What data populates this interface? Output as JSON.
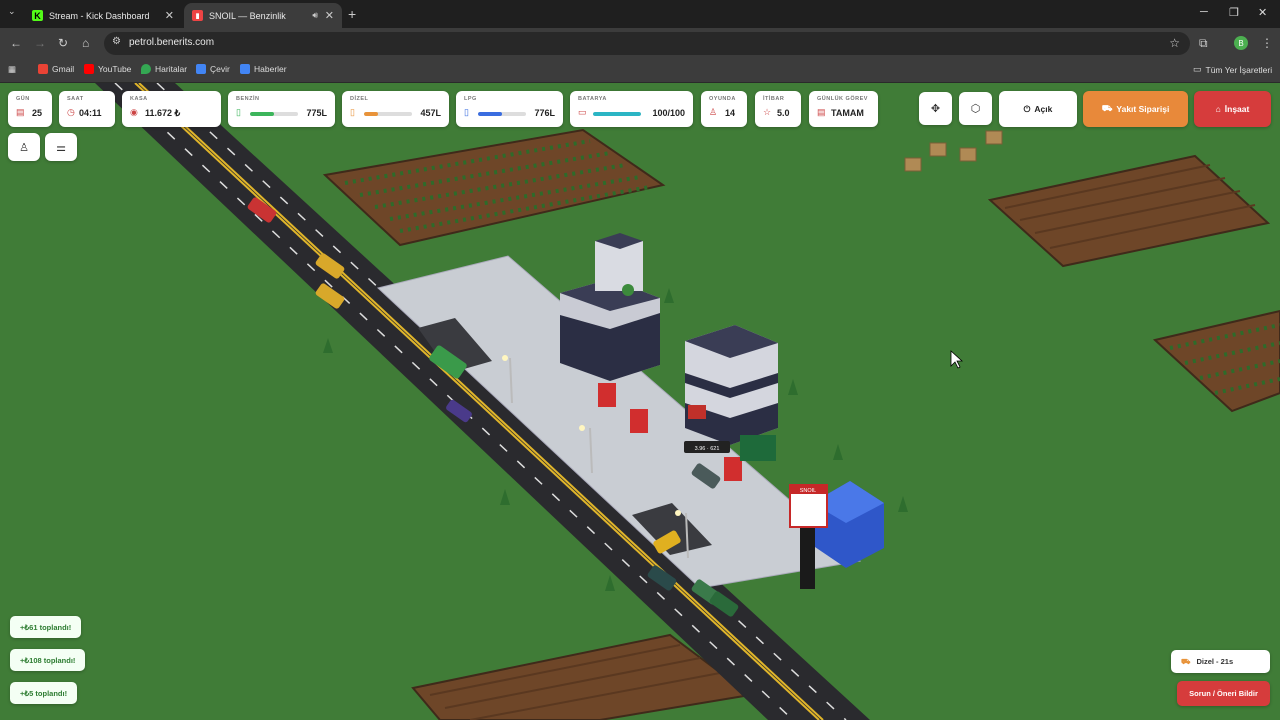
{
  "browser": {
    "tabs": [
      {
        "title": "Stream - Kick Dashboard",
        "icon": "kick-icon"
      },
      {
        "title": "SNOIL — Benzinlik",
        "icon": "snoil-icon"
      }
    ],
    "url": "petrol.benerits.com",
    "bookmarks": [
      {
        "label": "Gmail",
        "color": "#ea4335"
      },
      {
        "label": "YouTube",
        "color": "#ff0000"
      },
      {
        "label": "Haritalar",
        "color": "#34a853"
      },
      {
        "label": "Çevir",
        "color": "#4285f4"
      },
      {
        "label": "Haberler",
        "color": "#4285f4"
      }
    ],
    "all_bookmarks": "Tüm Yer İşaretleri",
    "profile_initial": "B"
  },
  "hud": {
    "gun": {
      "label": "GÜN",
      "value": "25"
    },
    "saat": {
      "label": "SAAT",
      "value": "04:11"
    },
    "kasa": {
      "label": "KASA",
      "value": "11.672 ₺"
    },
    "benzin": {
      "label": "BENZİN",
      "value": "775L",
      "level": 0.5,
      "color": "#3cb55b"
    },
    "dizel": {
      "label": "DİZEL",
      "value": "457L",
      "level": 0.3,
      "color": "#e8933a"
    },
    "lpg": {
      "label": "LPG",
      "value": "776L",
      "level": 0.5,
      "color": "#3a6de0"
    },
    "batarya": {
      "label": "BATARYA",
      "value": "100/100",
      "level": 1.0,
      "color": "#2bb5c4"
    },
    "oyunda": {
      "label": "OYUNDA",
      "value": "14"
    },
    "itibar": {
      "label": "İTİBAR",
      "value": "5.0"
    },
    "gorev": {
      "label": "GÜNLÜK GÖREV",
      "value": "TAMAM"
    }
  },
  "controls": {
    "acik": "Açık",
    "yakit_siparisi": "Yakıt Siparişi",
    "insaat": "İnşaat",
    "orange": "#e8893a",
    "red": "#d63c3c"
  },
  "toasts": [
    "+₺61 toplandı!",
    "+₺108 toplandı!",
    "+₺5 toplandı!"
  ],
  "bottom_right": {
    "dizel_timer": "Dizel - 21s",
    "report": "Sorun / Öneri Bildir"
  },
  "scene": {
    "price_sign": "SNOIL",
    "price_tag": "3.96 · 621"
  }
}
